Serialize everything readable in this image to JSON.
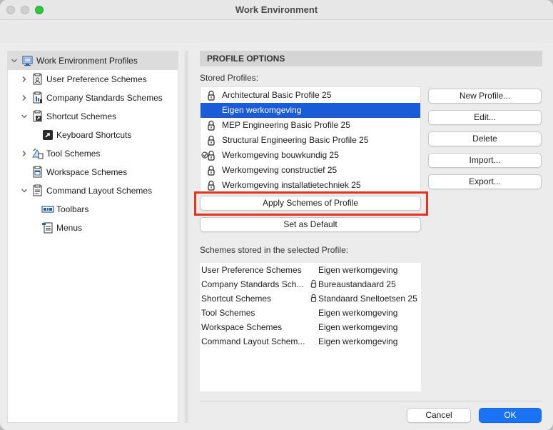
{
  "window": {
    "title": "Work Environment"
  },
  "tree": {
    "items": [
      {
        "label": "Work Environment Profiles",
        "icon": "profiles-icon",
        "expanded": true
      },
      {
        "label": "User Preference Schemes",
        "icon": "user-preference-icon"
      },
      {
        "label": "Company Standards Schemes",
        "icon": "company-standards-icon"
      },
      {
        "label": "Shortcut Schemes",
        "icon": "shortcut-schemes-icon",
        "expanded": true
      },
      {
        "label": "Keyboard Shortcuts",
        "icon": "keyboard-shortcut-icon"
      },
      {
        "label": "Tool Schemes",
        "icon": "tool-schemes-icon"
      },
      {
        "label": "Workspace Schemes",
        "icon": "workspace-schemes-icon"
      },
      {
        "label": "Command Layout Schemes",
        "icon": "command-layout-icon",
        "expanded": true
      },
      {
        "label": "Toolbars",
        "icon": "toolbars-icon"
      },
      {
        "label": "Menus",
        "icon": "menus-icon"
      }
    ]
  },
  "panel": {
    "header": "PROFILE OPTIONS",
    "stored_label": "Stored Profiles:",
    "profiles": [
      {
        "name": "Architectural Basic Profile 25",
        "locked": true
      },
      {
        "name": "Eigen werkomgeving",
        "locked": false,
        "selected": true
      },
      {
        "name": "MEP Engineering Basic Profile 25",
        "locked": true
      },
      {
        "name": "Structural Engineering Basic Profile 25",
        "locked": true
      },
      {
        "name": "Werkomgeving bouwkundig 25",
        "locked": true,
        "default": true
      },
      {
        "name": "Werkomgeving constructief 25",
        "locked": true
      },
      {
        "name": "Werkomgeving installatietechniek 25",
        "locked": true
      }
    ],
    "buttons": {
      "new_profile": "New Profile...",
      "edit": "Edit...",
      "delete": "Delete",
      "import": "Import...",
      "export": "Export...",
      "apply": "Apply Schemes of Profile",
      "set_default": "Set as Default"
    },
    "schemes_label": "Schemes stored in the selected Profile:",
    "schemes": [
      {
        "name": "User Preference Schemes",
        "value": "Eigen werkomgeving",
        "locked": false
      },
      {
        "name": "Company Standards Sch...",
        "value": "Bureaustandaard 25",
        "locked": true
      },
      {
        "name": "Shortcut Schemes",
        "value": "Standaard Sneltoetsen 25",
        "locked": true
      },
      {
        "name": "Tool Schemes",
        "value": "Eigen werkomgeving",
        "locked": false
      },
      {
        "name": "Workspace Schemes",
        "value": "Eigen werkomgeving",
        "locked": false
      },
      {
        "name": "Command Layout Schem...",
        "value": "Eigen werkomgeving",
        "locked": false
      }
    ]
  },
  "footer": {
    "cancel": "Cancel",
    "ok": "OK"
  },
  "colors": {
    "selection": "#1a5cd8",
    "primary": "#1a73f5",
    "highlight": "#e8311f"
  }
}
